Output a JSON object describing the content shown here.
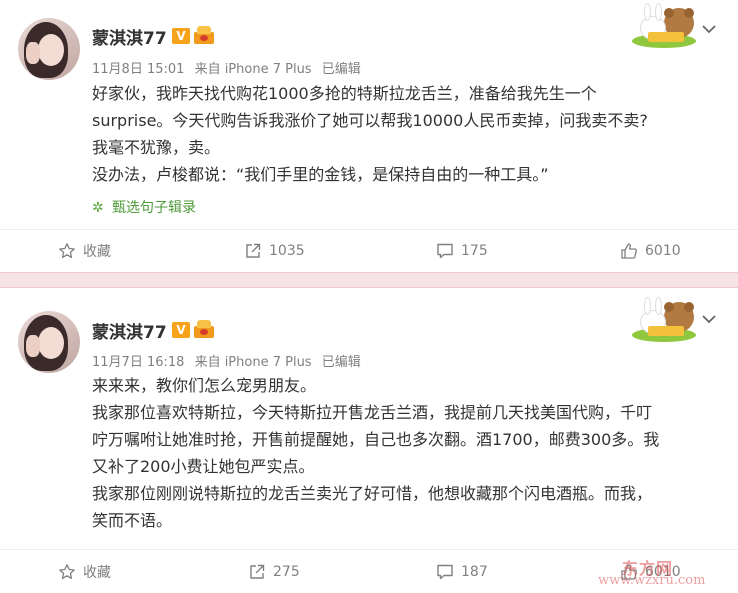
{
  "colors": {
    "accent_green": "#4e9a3a",
    "vip_orange": "#f7a21b",
    "separator_pink": "#f6e3e5",
    "meta_gray": "#808080"
  },
  "posts": [
    {
      "author": "蒙淇淇77",
      "vip_badge": "V",
      "badge_icon": "crown-badge-icon",
      "sticker_icon": "rabbit-bear-sticker-icon",
      "date": "11月8日 15:01",
      "source": "来自 iPhone 7 Plus",
      "edited": "已编辑",
      "lines": [
        "好家伙，我昨天找代购花1000多抢的特斯拉龙舌兰，准备给我先生一个",
        "surprise。今天代购告诉我涨价了她可以帮我10000人民币卖掉，问我卖不卖?",
        "我毫不犹豫，卖。",
        "没办法，卢梭都说：“我们手里的金钱，是保持自由的一种工具。”"
      ],
      "selector": "甄选句子辑录",
      "actions": {
        "favorite": "收藏",
        "repost": "1035",
        "comment": "175",
        "like": "6010"
      }
    },
    {
      "author": "蒙淇淇77",
      "vip_badge": "V",
      "badge_icon": "crown-badge-icon",
      "sticker_icon": "rabbit-bear-sticker-icon",
      "date": "11月7日 16:18",
      "source": "来自 iPhone 7 Plus",
      "edited": "已编辑",
      "lines": [
        "来来来，教你们怎么宠男朋友。",
        "我家那位喜欢特斯拉，今天特斯拉开售龙舌兰酒，我提前几天找美国代购，千叮",
        "咛万嘱咐让她准时抢，开售前提醒她，自己也多次翻。酒1700，邮费300多。我",
        "又补了200小费让她包严实点。",
        "我家那位刚刚说特斯拉的龙舌兰卖光了好可惜，他想收藏那个闪电酒瓶。而我，",
        "笑而不语。"
      ],
      "actions": {
        "favorite": "收藏",
        "repost": "275",
        "comment": "187",
        "like": "6010"
      }
    }
  ],
  "watermark": {
    "line1": "东方网",
    "line2": "www.wzxru.com"
  }
}
